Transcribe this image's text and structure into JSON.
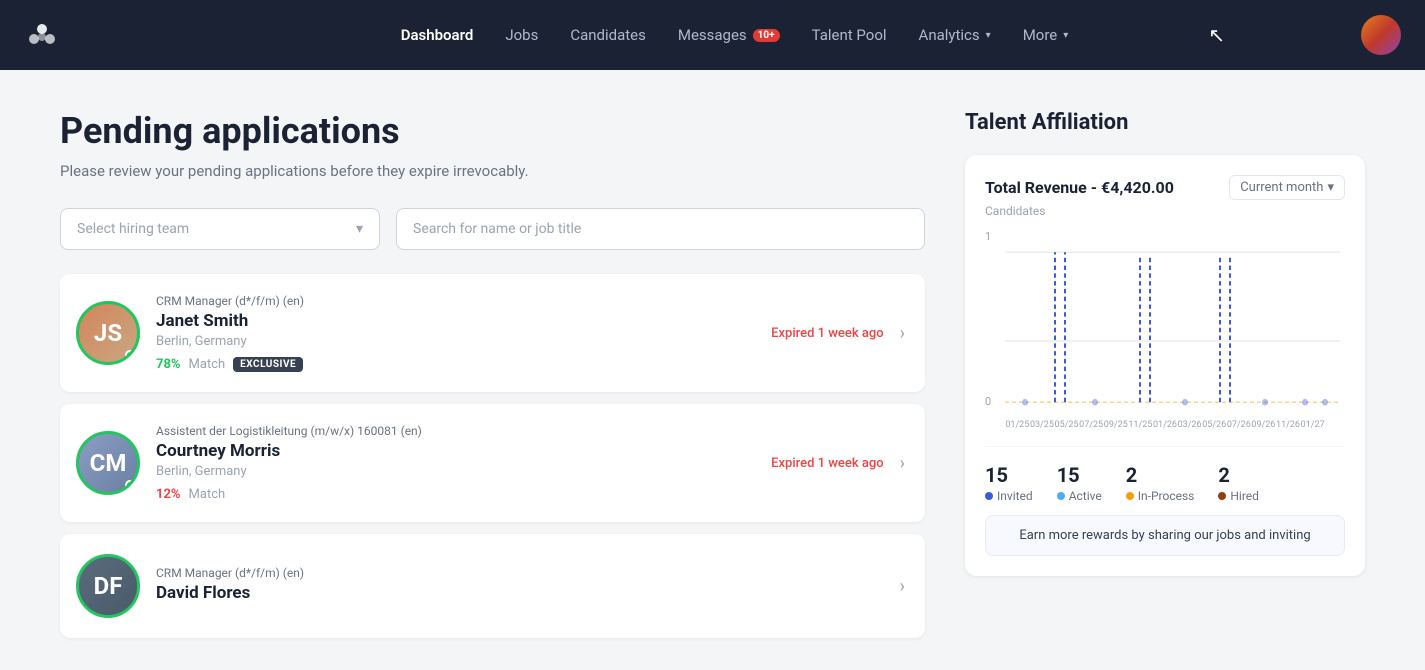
{
  "navbar": {
    "brand": "🌸",
    "links": [
      {
        "label": "Dashboard",
        "active": true,
        "badge": null,
        "hasChevron": false
      },
      {
        "label": "Jobs",
        "active": false,
        "badge": null,
        "hasChevron": false
      },
      {
        "label": "Candidates",
        "active": false,
        "badge": null,
        "hasChevron": false
      },
      {
        "label": "Messages",
        "active": false,
        "badge": "10+",
        "hasChevron": false
      },
      {
        "label": "Talent Pool",
        "active": false,
        "badge": null,
        "hasChevron": false
      },
      {
        "label": "Analytics",
        "active": false,
        "badge": null,
        "hasChevron": true
      },
      {
        "label": "More",
        "active": false,
        "badge": null,
        "hasChevron": true
      }
    ]
  },
  "page": {
    "title": "Pending applications",
    "subtitle": "Please review your pending applications before they expire irrevocably."
  },
  "filters": {
    "hiring_team_placeholder": "Select hiring team",
    "search_placeholder": "Search for name or job title"
  },
  "candidates": [
    {
      "job_title": "CRM Manager (d*/f/m) (en)",
      "name": "Janet Smith",
      "location": "Berlin, Germany",
      "match_pct": "78%",
      "match_class": "high",
      "tag": "EXCLUSIVE",
      "status": "Expired 1 week ago",
      "initials": "JS",
      "avatar_class": "avatar-janet"
    },
    {
      "job_title": "Assistent der Logistikleitung (m/w/x) 160081 (en)",
      "name": "Courtney Morris",
      "location": "Berlin, Germany",
      "match_pct": "12%",
      "match_class": "low",
      "tag": null,
      "status": "Expired 1 week ago",
      "initials": "CM",
      "avatar_class": "avatar-courtney"
    },
    {
      "job_title": "CRM Manager (d*/f/m) (en)",
      "name": "David Flores",
      "location": "",
      "match_pct": "",
      "match_class": "",
      "tag": null,
      "status": "",
      "initials": "DF",
      "avatar_class": "avatar-david"
    }
  ],
  "affiliation": {
    "panel_title": "Talent Affiliation",
    "total_revenue_label": "Total Revenue - €4,420.00",
    "candidates_label": "Candidates",
    "period": "Current month",
    "chart_y_max": "1",
    "chart_y_min": "0",
    "x_labels": [
      "",
      "",
      "",
      "",
      "",
      "",
      "",
      "",
      "",
      "",
      "",
      "",
      ""
    ],
    "stats": [
      {
        "value": "15",
        "label": "Invited",
        "dot_class": "dot-blue"
      },
      {
        "value": "15",
        "label": "Active",
        "dot_class": "dot-blue2"
      },
      {
        "value": "2",
        "label": "In-Process",
        "dot_class": "dot-orange"
      },
      {
        "value": "2",
        "label": "Hired",
        "dot_class": "dot-brown"
      }
    ],
    "earn_more_text": "Earn more rewards by sharing our jobs and inviting"
  }
}
